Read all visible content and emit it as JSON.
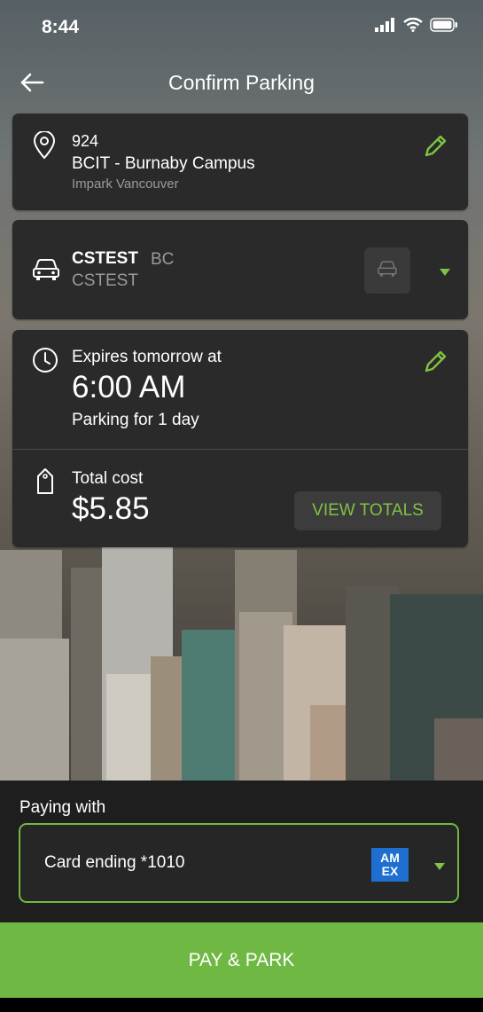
{
  "status_bar": {
    "time": "8:44"
  },
  "header": {
    "title": "Confirm Parking"
  },
  "location": {
    "lot_number": "924",
    "name": "BCIT - Burnaby Campus",
    "operator": "Impark Vancouver"
  },
  "vehicle": {
    "plate": "CSTEST",
    "province": "BC",
    "nickname": "CSTEST"
  },
  "expiry": {
    "label": "Expires tomorrow at",
    "time": "6:00 AM",
    "duration": "Parking for 1 day"
  },
  "cost": {
    "label": "Total cost",
    "amount": "$5.85",
    "view_totals_label": "VIEW TOTALS"
  },
  "payment": {
    "label": "Paying with",
    "card": "Card ending *1010",
    "card_brand_line1": "AM",
    "card_brand_line2": "EX"
  },
  "action": {
    "pay_label": "PAY & PARK"
  },
  "colors": {
    "accent": "#7fc244",
    "pay_button": "#6fb843",
    "card_bg": "#2a2a2a",
    "amex_blue": "#1f6fd1"
  }
}
